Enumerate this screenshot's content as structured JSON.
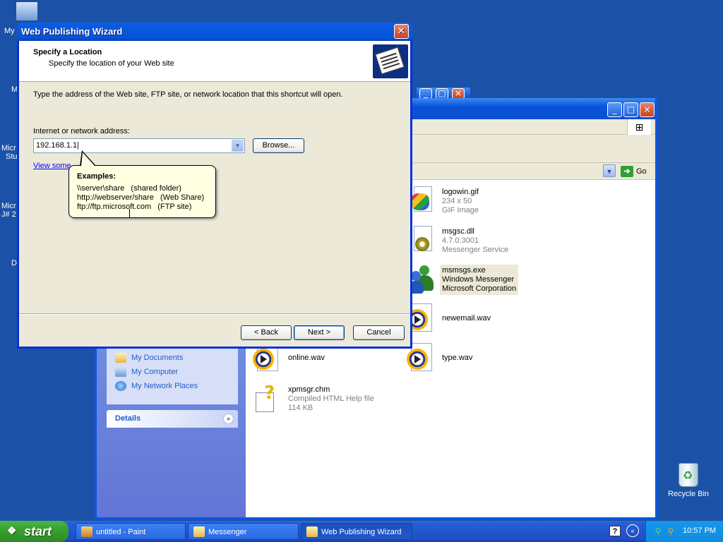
{
  "desktop": {
    "left_labels": [
      "My",
      "M",
      "Micr",
      "Stu",
      "Micr",
      "J# 2",
      "D"
    ],
    "recycle_bin_label": "Recycle Bin"
  },
  "explorer": {
    "go_label": "Go",
    "other_places": [
      "My Documents",
      "My Computer",
      "My Network Places"
    ],
    "details_label": "Details",
    "files": [
      {
        "name": "logowin.gif",
        "line2": "234 x 50",
        "line3": "GIF Image"
      },
      {
        "name": "msgsc.dll",
        "line2": "4.7.0.3001",
        "line3": "Messenger Service"
      },
      {
        "name": "msmsgs.exe",
        "line2": "Windows Messenger",
        "line3": "Microsoft Corporation"
      },
      {
        "name": "newemail.wav"
      },
      {
        "name": "online.wav"
      },
      {
        "name": "type.wav"
      },
      {
        "name": "xpmsgr.chm",
        "line2": "Compiled HTML Help file",
        "line3": "114 KB"
      }
    ]
  },
  "wizard": {
    "title": "Web Publishing Wizard",
    "heading": "Specify a Location",
    "subheading": "Specify the location of your Web site",
    "instructions": "Type the address of the Web site, FTP site, or network location that this shortcut will open.",
    "address_label": "Internet or network address:",
    "address_value": "192.168.1.1",
    "browse_label": "Browse...",
    "view_link": "View some",
    "back_label": "< Back",
    "next_label": "Next >",
    "cancel_label": "Cancel",
    "balloon": {
      "title": "Examples:",
      "lines": [
        "\\\\server\\share   (shared folder)",
        "http://webserver/share   (Web Share)",
        "ftp://ftp.microsoft.com   (FTP site)"
      ]
    }
  },
  "taskbar": {
    "start_label": "start",
    "tasks": [
      {
        "label": "untitled - Paint"
      },
      {
        "label": "Messenger"
      },
      {
        "label": "Web Publishing Wizard",
        "active": true
      }
    ],
    "clock": "10:57 PM"
  }
}
